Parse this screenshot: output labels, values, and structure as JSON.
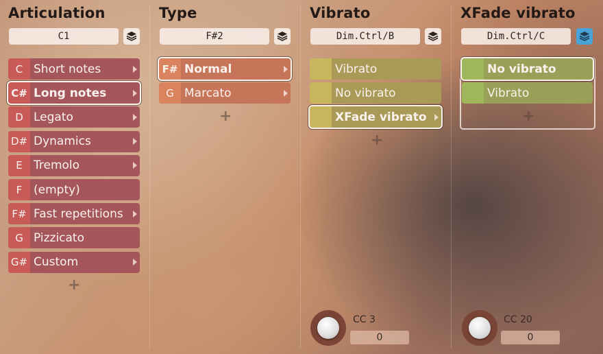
{
  "columns": [
    {
      "title": "Articulation",
      "key_field": "C1",
      "layer_active": false,
      "items": [
        {
          "key": "C",
          "label": "Short notes",
          "arrow": true,
          "selected": false
        },
        {
          "key": "C#",
          "label": "Long notes",
          "arrow": true,
          "selected": true
        },
        {
          "key": "D",
          "label": "Legato",
          "arrow": true,
          "selected": false
        },
        {
          "key": "D#",
          "label": "Dynamics",
          "arrow": true,
          "selected": false
        },
        {
          "key": "E",
          "label": "Tremolo",
          "arrow": true,
          "selected": false
        },
        {
          "key": "F",
          "label": "(empty)",
          "arrow": false,
          "selected": false
        },
        {
          "key": "F#",
          "label": "Fast repetitions",
          "arrow": true,
          "selected": false
        },
        {
          "key": "G",
          "label": "Pizzicato",
          "arrow": false,
          "selected": false
        },
        {
          "key": "G#",
          "label": "Custom",
          "arrow": true,
          "selected": false
        }
      ],
      "add_label": "+"
    },
    {
      "title": "Type",
      "key_field": "F#2",
      "layer_active": false,
      "items": [
        {
          "key": "F#",
          "label": "Normal",
          "arrow": true,
          "selected": true
        },
        {
          "key": "G",
          "label": "Marcato",
          "arrow": true,
          "selected": false
        }
      ],
      "add_label": "+"
    },
    {
      "title": "Vibrato",
      "key_field": "Dim.Ctrl/B",
      "layer_active": false,
      "items": [
        {
          "key": "",
          "label": "Vibrato",
          "arrow": false,
          "selected": false
        },
        {
          "key": "",
          "label": "No vibrato",
          "arrow": false,
          "selected": false
        },
        {
          "key": "",
          "label": "XFade vibrato",
          "arrow": true,
          "selected": true
        }
      ],
      "add_label": "+",
      "cc": {
        "label": "CC 3",
        "value": "0"
      }
    },
    {
      "title": "XFade vibrato",
      "key_field": "Dim.Ctrl/C",
      "layer_active": true,
      "items": [
        {
          "key": "",
          "label": "No vibrato",
          "arrow": false,
          "selected": true
        },
        {
          "key": "",
          "label": "Vibrato",
          "arrow": false,
          "selected": false
        }
      ],
      "add_label": "+",
      "cc": {
        "label": "CC 20",
        "value": "0"
      }
    }
  ],
  "colors": {
    "articulation_key": "#c85a58",
    "articulation_item": "#a4565a",
    "type_key": "#d9845f",
    "type_item": "#c67558",
    "vibrato_key": "#c7b65e",
    "vibrato_item": "#a99a58",
    "xfade_key": "#9fb65a",
    "xfade_item": "#9aa058",
    "layer_active": "#4aa3d6"
  },
  "icons": {
    "layer": "layers-icon",
    "arrow": "triangle-right-icon",
    "knob": "rotary-knob"
  }
}
